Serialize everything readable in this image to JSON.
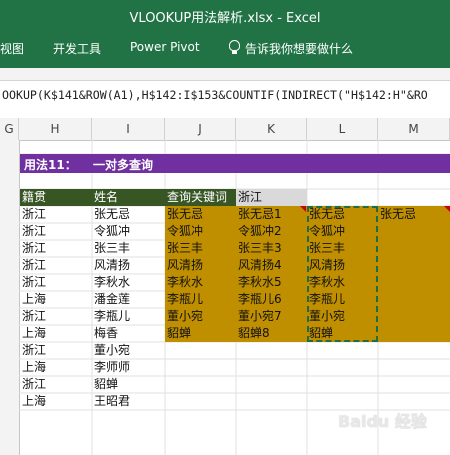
{
  "window": {
    "title": "VLOOKUP用法解析.xlsx  -  Excel"
  },
  "ribbon": {
    "tabs": [
      "视图",
      "开发工具",
      "Power Pivot"
    ],
    "tell_me": "告诉我你想要做什么"
  },
  "formula_bar": {
    "text": "OOKUP(K$141&ROW(A1),H$142:I$153&COUNTIF(INDIRECT(\"H$142:H\"&RO"
  },
  "columns": [
    "G",
    "H",
    "I",
    "J",
    "K",
    "L",
    "M"
  ],
  "banner": {
    "label": "用法11：",
    "title": "一对多查询"
  },
  "headers": {
    "province": "籍贯",
    "name": "姓名",
    "keyword_label": "查询关键词",
    "keyword_value": "浙江"
  },
  "source_rows": [
    {
      "province": "浙江",
      "name": "张无忌"
    },
    {
      "province": "浙江",
      "name": "令狐冲"
    },
    {
      "province": "浙江",
      "name": "张三丰"
    },
    {
      "province": "浙江",
      "name": "风清扬"
    },
    {
      "province": "浙江",
      "name": "李秋水"
    },
    {
      "province": "上海",
      "name": "潘金莲"
    },
    {
      "province": "浙江",
      "name": "李瓶儿"
    },
    {
      "province": "上海",
      "name": "梅香"
    },
    {
      "province": "浙江",
      "name": "董小宛"
    },
    {
      "province": "上海",
      "name": "李师师"
    },
    {
      "province": "浙江",
      "name": "貂蝉"
    },
    {
      "province": "上海",
      "name": "王昭君"
    }
  ],
  "result_J": [
    "张无忌",
    "令狐冲",
    "张三丰",
    "风清扬",
    "李秋水",
    "李瓶儿",
    "董小宛",
    "貂蝉"
  ],
  "result_K": [
    "张无忌1",
    "令狐冲2",
    "张三丰3",
    "风清扬4",
    "李秋水5",
    "李瓶儿6",
    "董小宛7",
    "貂蝉8"
  ],
  "result_L": [
    "张无忌",
    "令狐冲",
    "张三丰",
    "风清扬",
    "李秋水",
    "李瓶儿",
    "董小宛",
    "貂蝉"
  ],
  "result_M": [
    "张无忌"
  ],
  "watermark": "Baidu 经验",
  "colors": {
    "ribbon": "#217346",
    "banner": "#7030a0",
    "header_fill": "#375623",
    "result_fill": "#bf8f00",
    "keyword_fill": "#d9d9d9"
  }
}
